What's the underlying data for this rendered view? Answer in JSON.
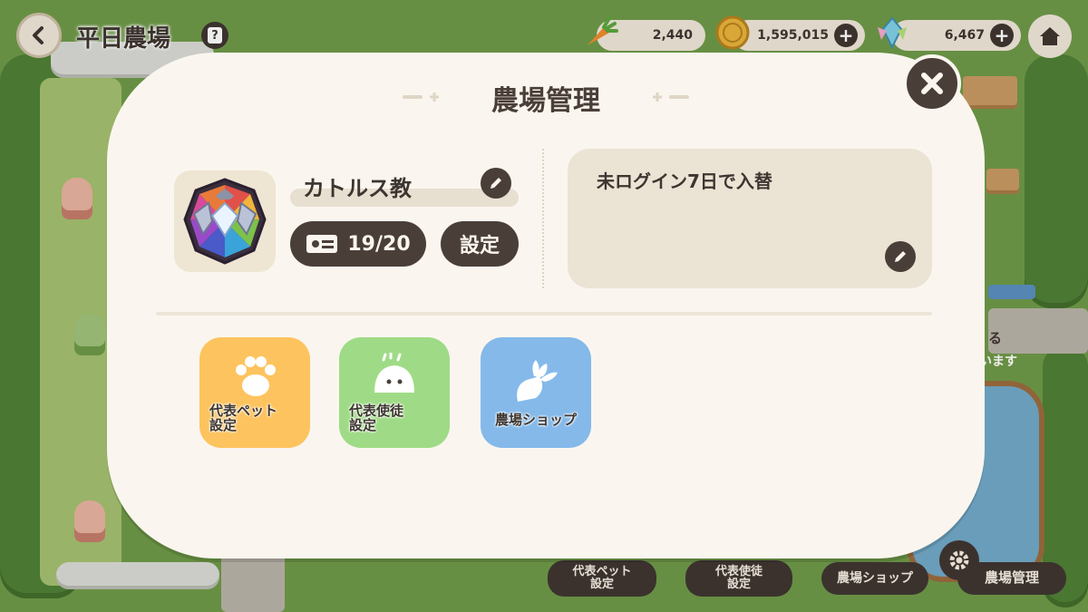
{
  "header": {
    "farm_name": "平日農場",
    "help_label": "?"
  },
  "currencies": [
    {
      "name": "carrot",
      "icon": "carrot-icon",
      "amount": "2,440"
    },
    {
      "name": "coin",
      "icon": "coin-icon",
      "amount": "1,595,015"
    },
    {
      "name": "gem",
      "icon": "crystal-icon",
      "amount": "6,467"
    }
  ],
  "modal": {
    "title": "農場管理",
    "farm_name": "カトルス教",
    "member_count": "19/20",
    "settings_label": "設定",
    "note": "未ログイン7日で入替",
    "actions": [
      {
        "id": "pet",
        "label": "代表ペット\n設定",
        "color": "#fdc35e",
        "icon": "paw-icon"
      },
      {
        "id": "disciple",
        "label": "代表使徒\n設定",
        "color": "#9fdb86",
        "icon": "blob-icon"
      },
      {
        "id": "shop",
        "label": "農場ショップ",
        "color": "#84b9ea",
        "icon": "radish-icon"
      }
    ]
  },
  "bottom_menu": {
    "pet": "代表ペット\n設定",
    "disciple": "代表使徒\n設定",
    "shop": "農場ショップ",
    "manage": "農場管理"
  },
  "background_text": {
    "sign1": "る",
    "sign2": "います"
  },
  "colors": {
    "dark": "#4a3f38",
    "panel": "#faf6ef",
    "note_bg": "#ebe3d4"
  }
}
